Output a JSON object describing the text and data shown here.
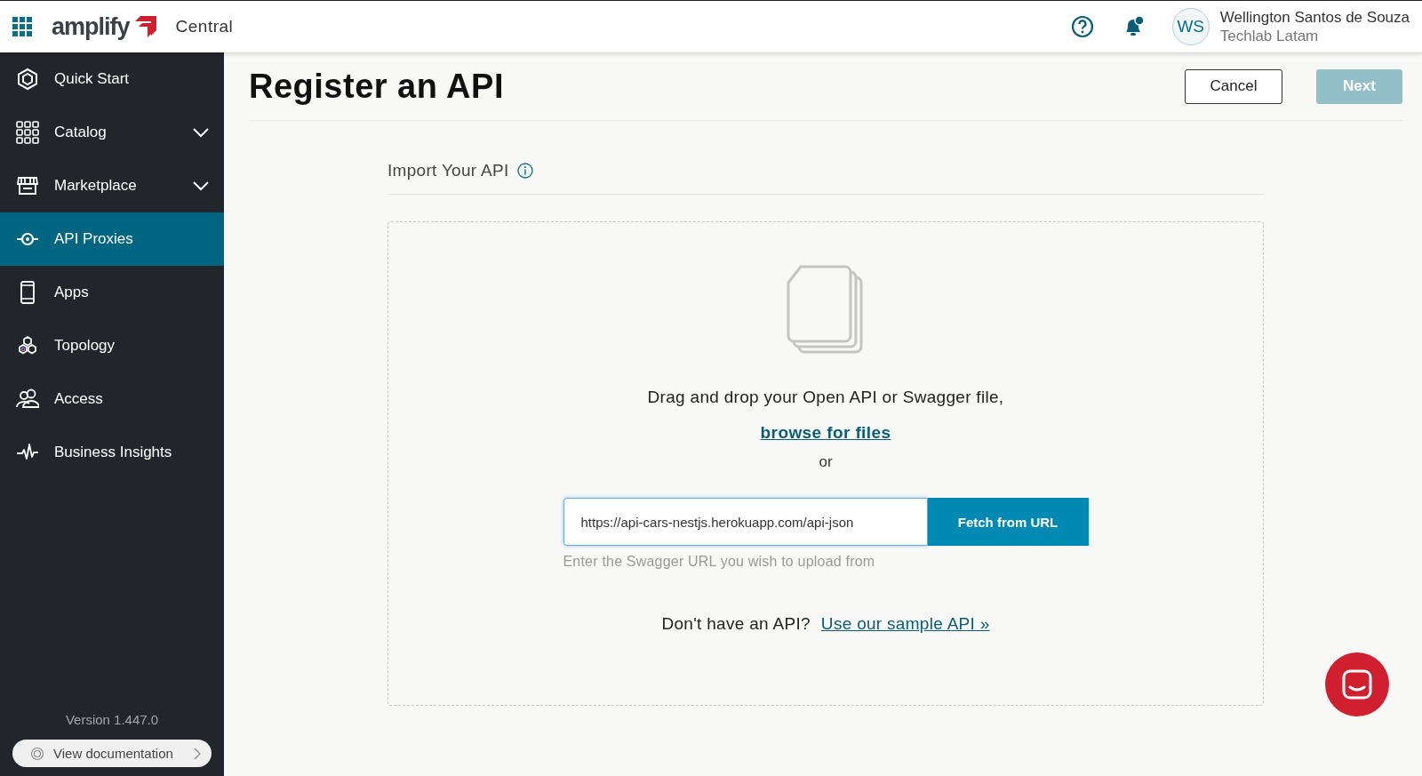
{
  "header": {
    "logo_text": "amplify",
    "product": "Central",
    "notification_dot": true,
    "user": {
      "initials": "WS",
      "name": "Wellington Santos de Souza",
      "org": "Techlab Latam"
    }
  },
  "sidebar": {
    "items": [
      {
        "label": "Quick Start",
        "kind": "hexagon",
        "selected": false
      },
      {
        "label": "Catalog",
        "kind": "grid",
        "selected": false,
        "expanded": false
      },
      {
        "label": "Marketplace",
        "kind": "store",
        "selected": false,
        "expanded": false
      },
      {
        "label": "API Proxies",
        "kind": "proxy",
        "selected": true
      },
      {
        "label": "Apps",
        "kind": "phone",
        "selected": false
      },
      {
        "label": "Topology",
        "kind": "hexagons",
        "selected": false
      },
      {
        "label": "Access",
        "kind": "people",
        "selected": false
      },
      {
        "label": "Business Insights",
        "kind": "pulse",
        "selected": false
      }
    ],
    "version": "Version 1.447.0",
    "doc_link": "View documentation"
  },
  "page": {
    "title": "Register an API",
    "buttons": [
      {
        "label": "Cancel",
        "kind": "secondary",
        "disabled": false
      },
      {
        "label": "Next",
        "kind": "primary",
        "disabled": true
      }
    ],
    "section_title": "Import Your API",
    "dropzone": {
      "prompt": "Drag and drop your Open API or Swagger file,",
      "browse_link": "browse for files",
      "or": "or",
      "url_field": {
        "value": "https://api-cars-nestjs.herokuapp.com/api-json",
        "helper": "Enter the Swagger URL you wish to upload from",
        "focused": true
      },
      "fetch_button": "Fetch from URL",
      "sample_prompt": "Don't have an API?",
      "sample_link": "Use our sample API »"
    }
  }
}
